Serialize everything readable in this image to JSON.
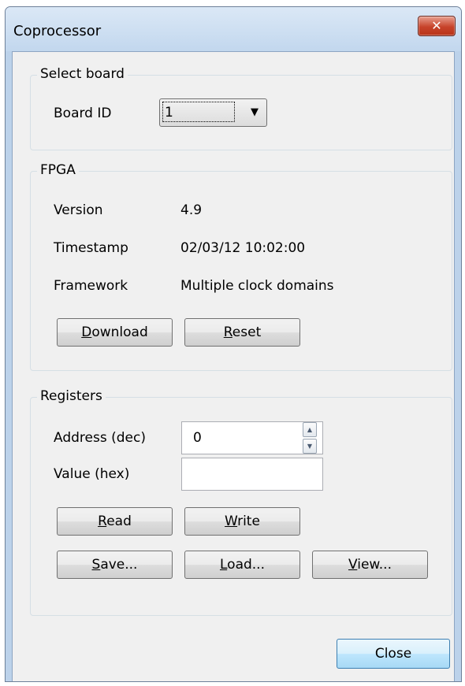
{
  "window": {
    "title": "Coprocessor",
    "close_glyph": "✕"
  },
  "select_board": {
    "group_label": "Select board",
    "board_id_label": "Board ID",
    "board_id_value": "1"
  },
  "fpga": {
    "group_label": "FPGA",
    "version_label": "Version",
    "version_value": "4.9",
    "timestamp_label": "Timestamp",
    "timestamp_value": "02/03/12 10:02:00",
    "framework_label": "Framework",
    "framework_value": "Multiple clock domains",
    "download_button": {
      "mnemonic": "D",
      "rest": "ownload"
    },
    "reset_button": {
      "mnemonic": "R",
      "rest": "eset"
    }
  },
  "registers": {
    "group_label": "Registers",
    "address_label": "Address (dec)",
    "address_value": "0",
    "value_label": "Value (hex)",
    "value_value": "",
    "read_button": {
      "mnemonic": "R",
      "rest": "ead"
    },
    "write_button": {
      "mnemonic": "W",
      "rest": "rite"
    },
    "save_button": {
      "mnemonic": "S",
      "rest": "ave..."
    },
    "load_button": {
      "mnemonic": "L",
      "rest": "oad..."
    },
    "view_button": {
      "mnemonic": "V",
      "rest": "iew..."
    }
  },
  "footer": {
    "close_button": "Close"
  }
}
